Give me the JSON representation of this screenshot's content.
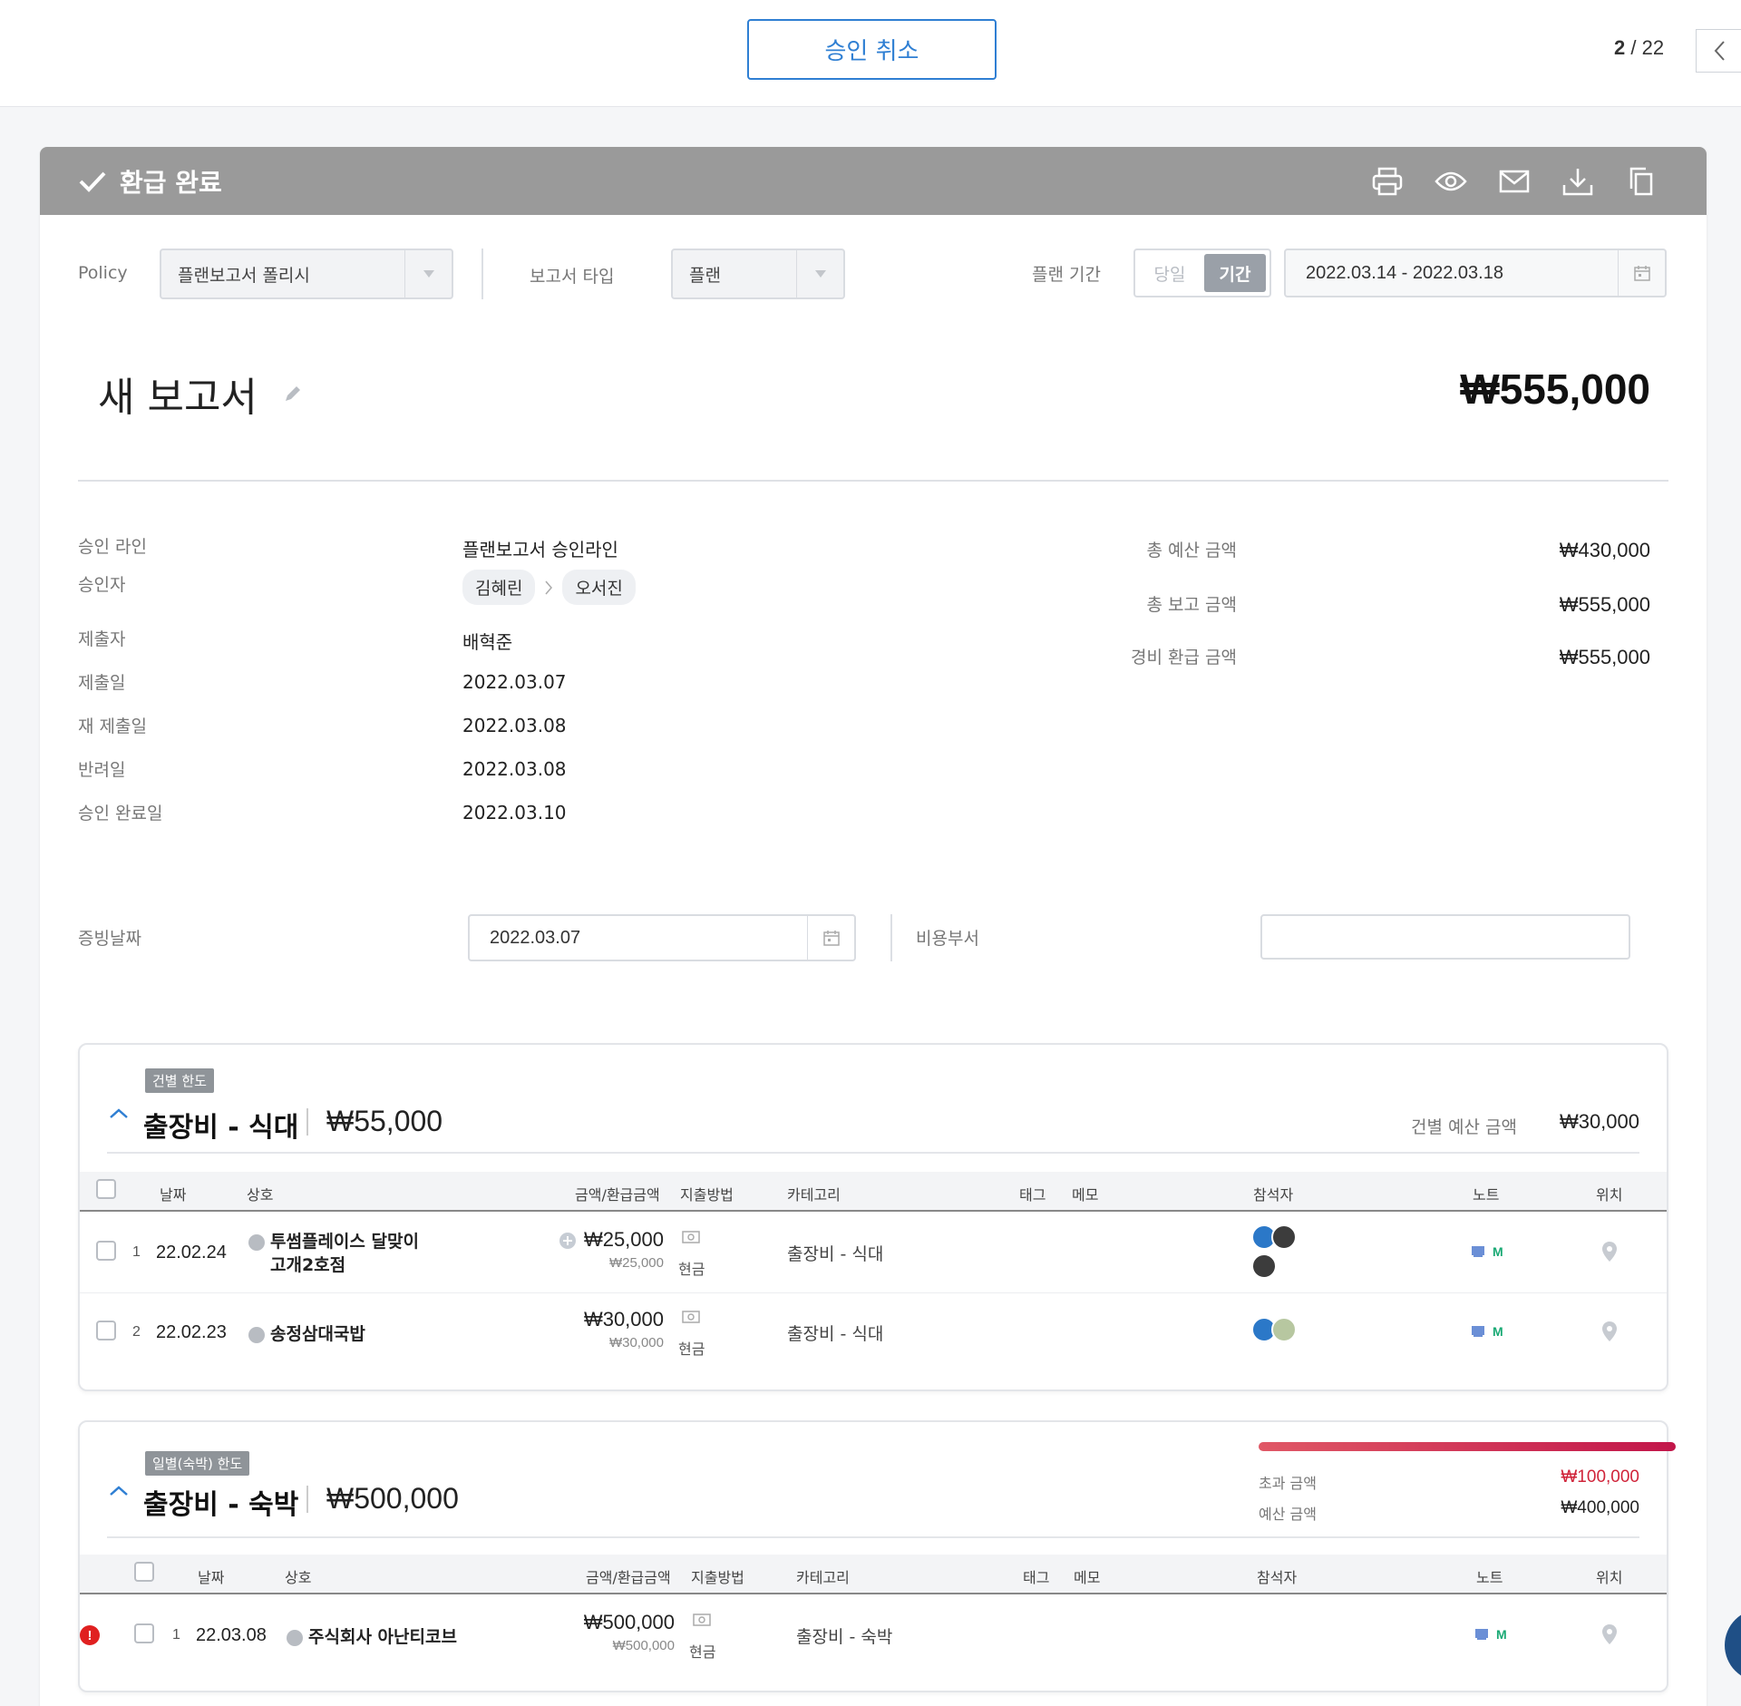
{
  "topbar": {
    "cancel_approval_label": "승인 취소",
    "pager_current": "2",
    "pager_total": "/ 22"
  },
  "status": {
    "title": "환급 완료",
    "color": "#9a9a9a",
    "icons": [
      "print-icon",
      "eye-icon",
      "mail-icon",
      "download-icon",
      "copy-icon"
    ]
  },
  "filters": {
    "policy_label": "Policy",
    "policy_value": "플랜보고서 폴리시",
    "report_type_label": "보고서 타입",
    "report_type_value": "플랜",
    "plan_period_label": "플랜 기간",
    "seg_day": "당일",
    "seg_period": "기간",
    "date_range": "2022.03.14 - 2022.03.18"
  },
  "report": {
    "title": "새 보고서",
    "total": "₩555,000"
  },
  "info": {
    "approval_line_label": "승인 라인",
    "approval_line_value": "플랜보고서 승인라인",
    "approvers_label": "승인자",
    "approvers": [
      "김혜린",
      "오서진"
    ],
    "submitter_label": "제출자",
    "submitter_value": "배혁준",
    "submit_date_label": "제출일",
    "submit_date_value": "2022.03.07",
    "resubmit_date_label": "재 제출일",
    "resubmit_date_value": "2022.03.08",
    "return_date_label": "반려일",
    "return_date_value": "2022.03.08",
    "approved_date_label": "승인 완료일",
    "approved_date_value": "2022.03.10"
  },
  "summary": {
    "budget_label": "총 예산 금액",
    "budget_value": "₩430,000",
    "report_label": "총 보고 금액",
    "report_value": "₩555,000",
    "refund_label": "경비 환급 금액",
    "refund_value": "₩555,000"
  },
  "evidence": {
    "date_label": "증빙날짜",
    "date_value": "2022.03.07",
    "cost_dept_label": "비용부서",
    "cost_dept_value": ""
  },
  "columns": {
    "date": "날짜",
    "merchant": "상호",
    "amount": "금액/환급금액",
    "payment": "지출방법",
    "category": "카테고리",
    "tag": "태그",
    "memo": "메모",
    "attendees": "참석자",
    "note": "노트",
    "location": "위치"
  },
  "groups": [
    {
      "tag": "건별 한도",
      "title": "출장비 - 식대",
      "amount": "₩55,000",
      "budget_label": "건별 예산 금액",
      "budget_value": "₩30,000",
      "rows": [
        {
          "no": "1",
          "date": "22.02.24",
          "merchant": "투썸플레이스 달맞이",
          "merchant2": "고개2호점",
          "amount": "₩25,000",
          "refund": "₩25,000",
          "payment": "현금",
          "category": "출장비 - 식대",
          "note": "M"
        },
        {
          "no": "2",
          "date": "22.02.23",
          "merchant": "송정삼대국밥",
          "merchant2": "",
          "amount": "₩30,000",
          "refund": "₩30,000",
          "payment": "현금",
          "category": "출장비 - 식대",
          "note": "M"
        }
      ]
    },
    {
      "tag": "일별(숙박) 한도",
      "title": "출장비 - 숙박",
      "amount": "₩500,000",
      "over_label": "초과 금액",
      "over_value": "₩100,000",
      "budget_label": "예산 금액",
      "budget_value": "₩400,000",
      "over_color": "#d0243a",
      "progress": 1.0,
      "rows": [
        {
          "no": "1",
          "date": "22.03.08",
          "merchant": "주식회사 아난티코브",
          "amount": "₩500,000",
          "refund": "₩500,000",
          "payment": "현금",
          "category": "출장비 - 숙박",
          "note": "M",
          "alert": "!"
        }
      ]
    }
  ]
}
